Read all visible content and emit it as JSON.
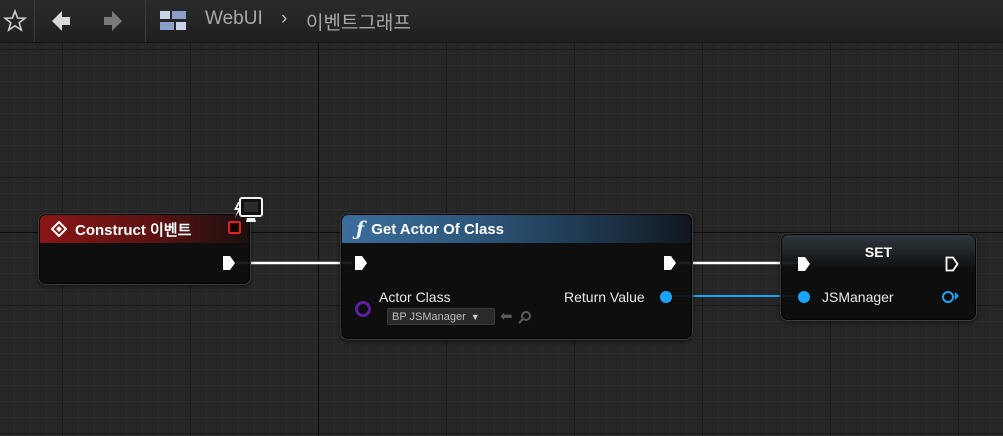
{
  "toolbar": {
    "favorite_icon": "star-icon",
    "back_icon": "arrow-left-icon",
    "forward_icon": "arrow-right-icon",
    "graph_icon": "graph-icon"
  },
  "breadcrumb": {
    "root": "WebUI",
    "separator": "›",
    "current": "이벤트그래프"
  },
  "nodes": {
    "construct": {
      "title": "Construct 이벤트",
      "header_color": "#8a1616"
    },
    "get_actor": {
      "title": "Get Actor Of Class",
      "header_color": "#3b6e9c",
      "input_label": "Actor Class",
      "input_value": "BP JSManager",
      "output_label": "Return Value"
    },
    "set": {
      "title": "SET",
      "variable_label": "JSManager"
    }
  },
  "colors": {
    "object_pin": "#1ba3f5",
    "class_pin": "#5a1fa0",
    "exec_wire": "#ffffff"
  }
}
